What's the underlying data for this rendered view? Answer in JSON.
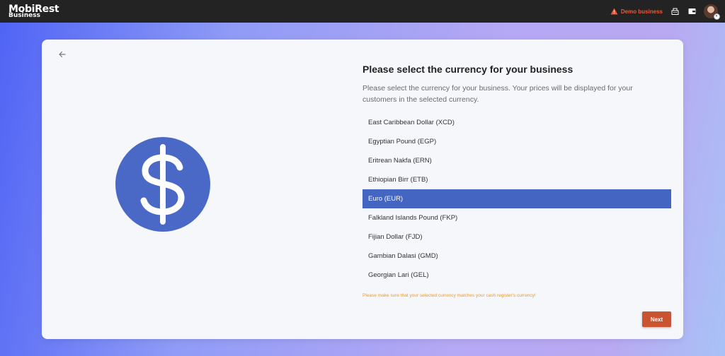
{
  "header": {
    "logo_line1": "MobiRest",
    "logo_line2": "Business",
    "demo_label": "Demo business",
    "icons": [
      "warning-icon",
      "cash-register-icon",
      "wallet-icon",
      "avatar"
    ]
  },
  "colors": {
    "accent": "#4565c2",
    "warning": "#e89a2e",
    "next_button": "#c9542f",
    "demo_text": "#e85a3c"
  },
  "main": {
    "title": "Please select the currency for your business",
    "description": "Please select the currency for your business. Your prices will be displayed for your customers in the selected currency.",
    "currencies": [
      "East Caribbean Dollar (XCD)",
      "Egyptian Pound (EGP)",
      "Eritrean Nakfa (ERN)",
      "Ethiopian Birr (ETB)",
      "Euro (EUR)",
      "Falkland Islands Pound (FKP)",
      "Fijian Dollar (FJD)",
      "Gambian Dalasi (GMD)",
      "Georgian Lari (GEL)"
    ],
    "selected": "Euro (EUR)",
    "warning": "Please make sure that your selected currency matches your cash register's currency!",
    "next_label": "Next"
  }
}
